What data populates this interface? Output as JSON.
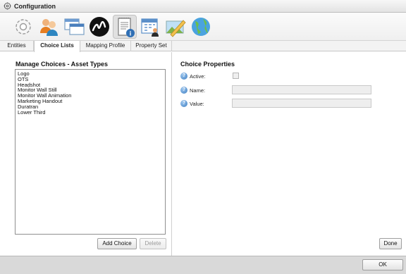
{
  "window": {
    "title": "Configuration",
    "title_icon": "gear-icon"
  },
  "toolbar": {
    "items": [
      {
        "name": "gear-settings",
        "icon": "gear-icon"
      },
      {
        "name": "users",
        "icon": "users-icon"
      },
      {
        "name": "windows",
        "icon": "windows-icon"
      },
      {
        "name": "brand-logo",
        "icon": "logo-icon"
      },
      {
        "name": "document-info",
        "icon": "document-info-icon"
      },
      {
        "name": "calendar-user",
        "icon": "calendar-user-icon"
      },
      {
        "name": "image-edit",
        "icon": "image-pencil-icon"
      },
      {
        "name": "globe",
        "icon": "globe-icon"
      }
    ]
  },
  "tabs": [
    {
      "label": "Entities"
    },
    {
      "label": "Choice Lists",
      "active": true
    },
    {
      "label": "Mapping Profile"
    },
    {
      "label": "Property Set"
    }
  ],
  "left_panel": {
    "heading": "Manage Choices - Asset Types",
    "items": [
      "Logo",
      "OTS",
      "Headshot",
      "Monitor Wall Still",
      "Monitor Wall Animation",
      "Marketing Handout",
      "Duratran",
      "Lower Third"
    ],
    "add_label": "Add Choice",
    "delete_label": "Delete"
  },
  "right_panel": {
    "heading": "Choice Properties",
    "active_label": "Active:",
    "name_label": "Name:",
    "value_label": "Value:",
    "name_value": "",
    "value_value": "",
    "help_glyph": "?",
    "done_label": "Done"
  },
  "footer": {
    "ok_label": "OK"
  },
  "colors": {
    "help_blue": "#3f7fc3",
    "footer_gray": "#d9d9d9"
  }
}
